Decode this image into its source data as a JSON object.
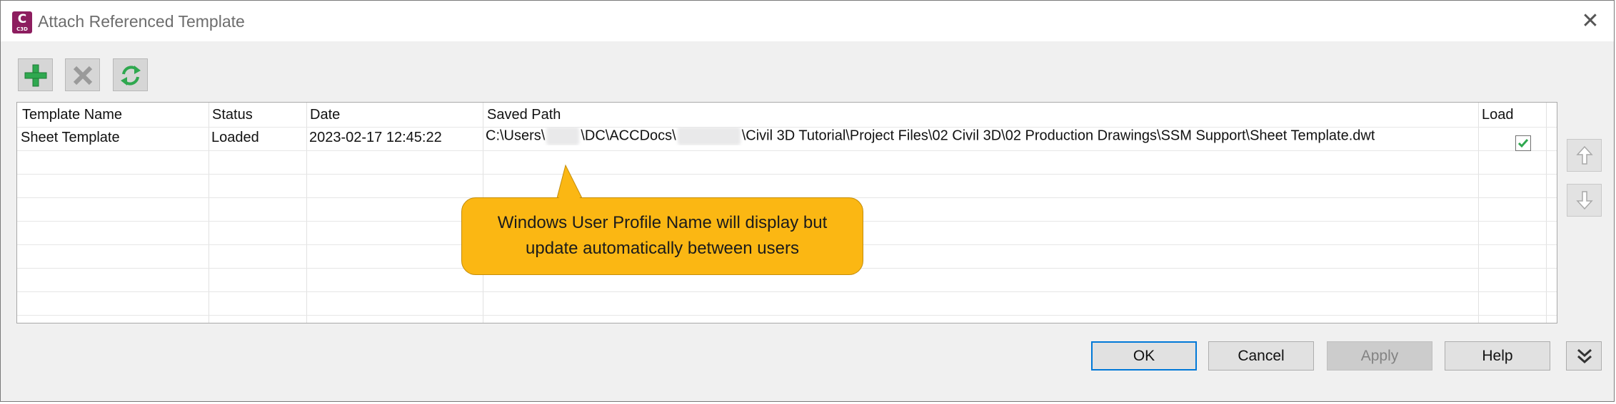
{
  "window": {
    "title": "Attach Referenced Template",
    "app_icon": {
      "letter": "C",
      "caption": "C3D",
      "color": "#8d1d5f"
    },
    "close_glyph": "✕"
  },
  "toolbar": {
    "add_icon": "plus-icon",
    "remove_icon": "x-icon",
    "refresh_icon": "refresh-icon"
  },
  "grid": {
    "columns": [
      "Template Name",
      "Status",
      "Date",
      "Saved Path",
      "Load"
    ],
    "rows": [
      {
        "template_name": "Sheet Template",
        "status": "Loaded",
        "date": "2023-02-17 12:45:22",
        "path_prefix": "C:\\Users\\",
        "path_mid": "\\DC\\ACCDocs\\",
        "path_suffix": "\\Civil 3D Tutorial\\Project Files\\02 Civil 3D\\02 Production Drawings\\SSM Support\\Sheet Template.dwt",
        "load_checked": true
      }
    ]
  },
  "callout": {
    "line1": "Windows User Profile Name will display but",
    "line2": "update automatically between users",
    "color": "#fbb713"
  },
  "side": {
    "up_icon": "arrow-up-icon",
    "down_icon": "arrow-down-icon"
  },
  "buttons": {
    "ok": "OK",
    "cancel": "Cancel",
    "apply": "Apply",
    "help": "Help",
    "expand_icon": "double-chevron-down-icon"
  },
  "colors": {
    "accent": "#0078d7",
    "green": "#2fa84f"
  }
}
